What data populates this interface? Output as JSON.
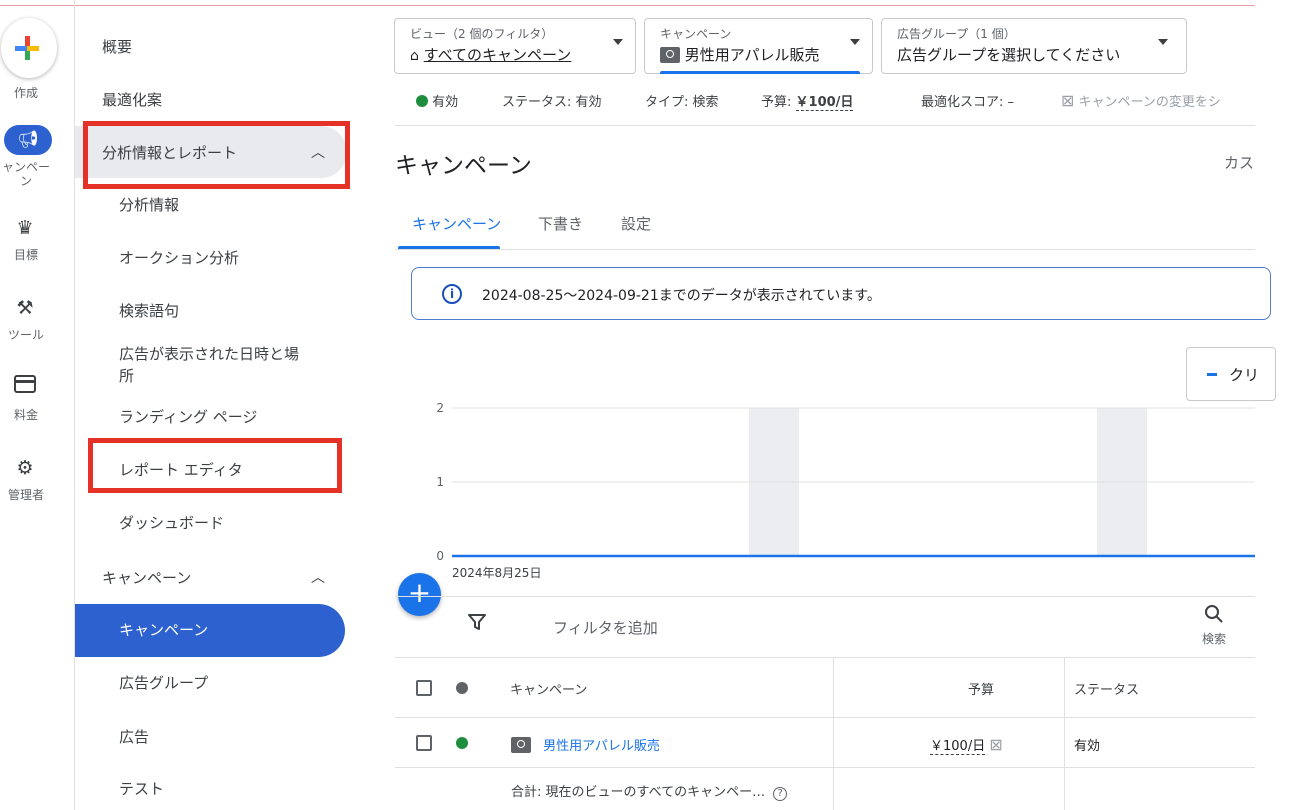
{
  "rail": {
    "create_label": "作成",
    "items": [
      {
        "label": "キャンペーン",
        "icon": "megaphone-icon"
      },
      {
        "label": "目標",
        "icon": "trophy-icon"
      },
      {
        "label": "ツール",
        "icon": "tools-icon"
      },
      {
        "label": "料金",
        "icon": "credit-card-icon"
      },
      {
        "label": "管理者",
        "icon": "gear-icon"
      }
    ],
    "camp_label_line1": "ャンペー",
    "camp_label_line2": "ン"
  },
  "nav": {
    "overview": "概要",
    "recommendations": "最適化案",
    "insights_reports": "分析情報とレポート",
    "sub": [
      "分析情報",
      "オークション分析",
      "検索語句",
      "広告が表示された日時と場",
      "所",
      "ランディング ページ",
      "レポート エディタ",
      "ダッシュボード"
    ],
    "campaigns_group": "キャンペーン",
    "campaigns_sub": [
      "キャンペーン",
      "広告グループ",
      "広告",
      "テスト"
    ]
  },
  "header": {
    "view_small": "ビュー（2 個のフィルタ）",
    "view_value": "すべてのキャンペーン",
    "campaign_small": "キャンペーン",
    "campaign_value": "男性用アパレル販売",
    "adgroup_small": "広告グループ（1 個）",
    "adgroup_value": "広告グループを選択してください"
  },
  "status_bar": {
    "enabled": "有効",
    "status": "ステータス: 有効",
    "type": "タイプ: 検索",
    "budget_label": "予算:",
    "budget_value": "￥100/日",
    "opt_score": "最適化スコア: –",
    "change_text": "キャンペーンの変更をシ"
  },
  "page": {
    "title": "キャンペーン",
    "custom": "カス",
    "tabs": [
      "キャンペーン",
      "下書き",
      "設定"
    ],
    "info": "2024-08-25～2024-09-21までのデータが表示されています。",
    "legend": "クリ"
  },
  "chart_data": {
    "type": "line",
    "y_ticks": [
      "2",
      "1",
      "0"
    ],
    "ylim": [
      0,
      2
    ],
    "x_start_label": "2024年8月25日",
    "series": [
      {
        "values": [
          0,
          0,
          0,
          0,
          0,
          0,
          0,
          0,
          0,
          0,
          0,
          0,
          0,
          0,
          0,
          0,
          0,
          0,
          0,
          0,
          0,
          0,
          0,
          0,
          0,
          0,
          0,
          0
        ]
      }
    ]
  },
  "table": {
    "filter_add": "フィルタを追加",
    "search": "検索",
    "headers": {
      "campaign": "キャンペーン",
      "budget": "予算",
      "status": "ステータス"
    },
    "row": {
      "campaign": "男性用アパレル販売",
      "budget": "￥100/日",
      "status": "有効"
    },
    "total": "合計: 現在のビューのすべてのキャンペー…"
  },
  "colors": {
    "primary": "#1a73e8",
    "active_nav": "#2c61cf",
    "enabled_green": "#1e8e3e",
    "highlight_red": "#e53228"
  }
}
